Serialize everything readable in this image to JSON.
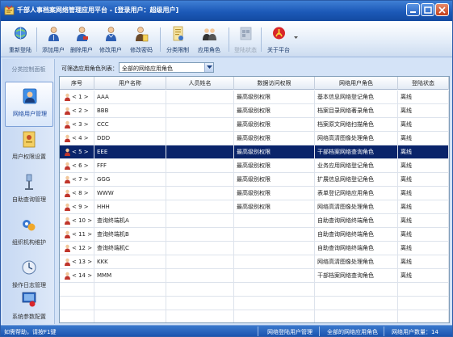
{
  "window": {
    "title": "千部人事档案网络管理应用平台 - [登录用户：超级用户]",
    "controls": [
      "minimize",
      "maximize",
      "close"
    ]
  },
  "toolbar": {
    "buttons": [
      {
        "label": "重新登陆",
        "icon": "globe-icon",
        "enabled": true
      },
      {
        "label": "添加用户",
        "icon": "add-user-icon",
        "enabled": true
      },
      {
        "label": "删除用户",
        "icon": "delete-user-icon",
        "enabled": true
      },
      {
        "label": "修改用户",
        "icon": "edit-user-icon",
        "enabled": true
      },
      {
        "label": "修改密码",
        "icon": "password-icon",
        "enabled": true
      },
      {
        "label": "分类限制",
        "icon": "category-limit-icon",
        "enabled": true
      },
      {
        "label": "应用角色",
        "icon": "role-icon",
        "enabled": true
      },
      {
        "label": "登陆状态",
        "icon": "login-status-icon",
        "enabled": false
      },
      {
        "label": "关于平台",
        "icon": "about-icon",
        "enabled": true
      }
    ]
  },
  "sidebar": {
    "header": "分类控制面板",
    "items": [
      {
        "label": "网络用户管理",
        "icon": "network-user-icon",
        "active": true
      },
      {
        "label": "用户权限设置",
        "icon": "permission-icon",
        "active": false
      },
      {
        "label": "自助查询管理",
        "icon": "self-query-icon",
        "active": false
      },
      {
        "label": "组织机构维护",
        "icon": "organization-icon",
        "active": false
      },
      {
        "label": "操作日志管理",
        "icon": "log-icon",
        "active": false
      },
      {
        "label": "系统参数配置",
        "icon": "config-icon",
        "active": false
      }
    ]
  },
  "filter": {
    "label": "可筛选应用角色列表：",
    "selected": "全部的网络应用角色"
  },
  "table": {
    "columns": [
      "序号",
      "用户名称",
      "人员姓名",
      "数据访问权限",
      "网络用户角色",
      "登陆状态"
    ],
    "rows": [
      {
        "idx": "< 1 >",
        "name": "AAA",
        "person": "",
        "access": "最高级别权限",
        "role": "基本信息网络登记角色",
        "status": "离线",
        "selected": false
      },
      {
        "idx": "< 2 >",
        "name": "BBB",
        "person": "",
        "access": "最高级别权限",
        "role": "档案目录网络著录角色",
        "status": "离线",
        "selected": false
      },
      {
        "idx": "< 3 >",
        "name": "CCC",
        "person": "",
        "access": "最高级别权限",
        "role": "档案原文网络扫描角色",
        "status": "离线",
        "selected": false
      },
      {
        "idx": "< 4 >",
        "name": "DDD",
        "person": "",
        "access": "最高级别权限",
        "role": "网络高清图像处理角色",
        "status": "离线",
        "selected": false
      },
      {
        "idx": "< 5 >",
        "name": "EEE",
        "person": "",
        "access": "最高级别权限",
        "role": "干部档案网络查询角色",
        "status": "离线",
        "selected": true
      },
      {
        "idx": "< 6 >",
        "name": "FFF",
        "person": "",
        "access": "最高级别权限",
        "role": "业务应用网络登记角色",
        "status": "离线",
        "selected": false
      },
      {
        "idx": "< 7 >",
        "name": "GGG",
        "person": "",
        "access": "最高级别权限",
        "role": "扩展信息网络登记角色",
        "status": "离线",
        "selected": false
      },
      {
        "idx": "< 8 >",
        "name": "WWW",
        "person": "",
        "access": "最高级别权限",
        "role": "表单登记网络应用角色",
        "status": "离线",
        "selected": false
      },
      {
        "idx": "< 9 >",
        "name": "HHH",
        "person": "",
        "access": "最高级别权限",
        "role": "网络高清图像处理角色",
        "status": "离线",
        "selected": false
      },
      {
        "idx": "< 10 >",
        "name": "查询终端机A",
        "person": "",
        "access": "",
        "role": "自助查询网络终端角色",
        "status": "离线",
        "selected": false
      },
      {
        "idx": "< 11 >",
        "name": "查询终端机B",
        "person": "",
        "access": "",
        "role": "自助查询网络终端角色",
        "status": "离线",
        "selected": false
      },
      {
        "idx": "< 12 >",
        "name": "查询终端机C",
        "person": "",
        "access": "",
        "role": "自助查询网络终端角色",
        "status": "离线",
        "selected": false
      },
      {
        "idx": "< 13 >",
        "name": "KKK",
        "person": "",
        "access": "",
        "role": "网络高清图像处理角色",
        "status": "离线",
        "selected": false
      },
      {
        "idx": "< 14 >",
        "name": "MMM",
        "person": "",
        "access": "",
        "role": "干部档案网络查询角色",
        "status": "离线",
        "selected": false
      }
    ]
  },
  "status": {
    "help": "如需帮助，请按F1键",
    "module": "网络登陆用户管理",
    "role_filter": "全部的网络应用角色",
    "count": "网络用户数量：14"
  },
  "colors": {
    "titlebar": "#1c59b8",
    "selection": "#0a246a",
    "background": "#d4e3f7",
    "statusbar": "#1b55b0"
  }
}
